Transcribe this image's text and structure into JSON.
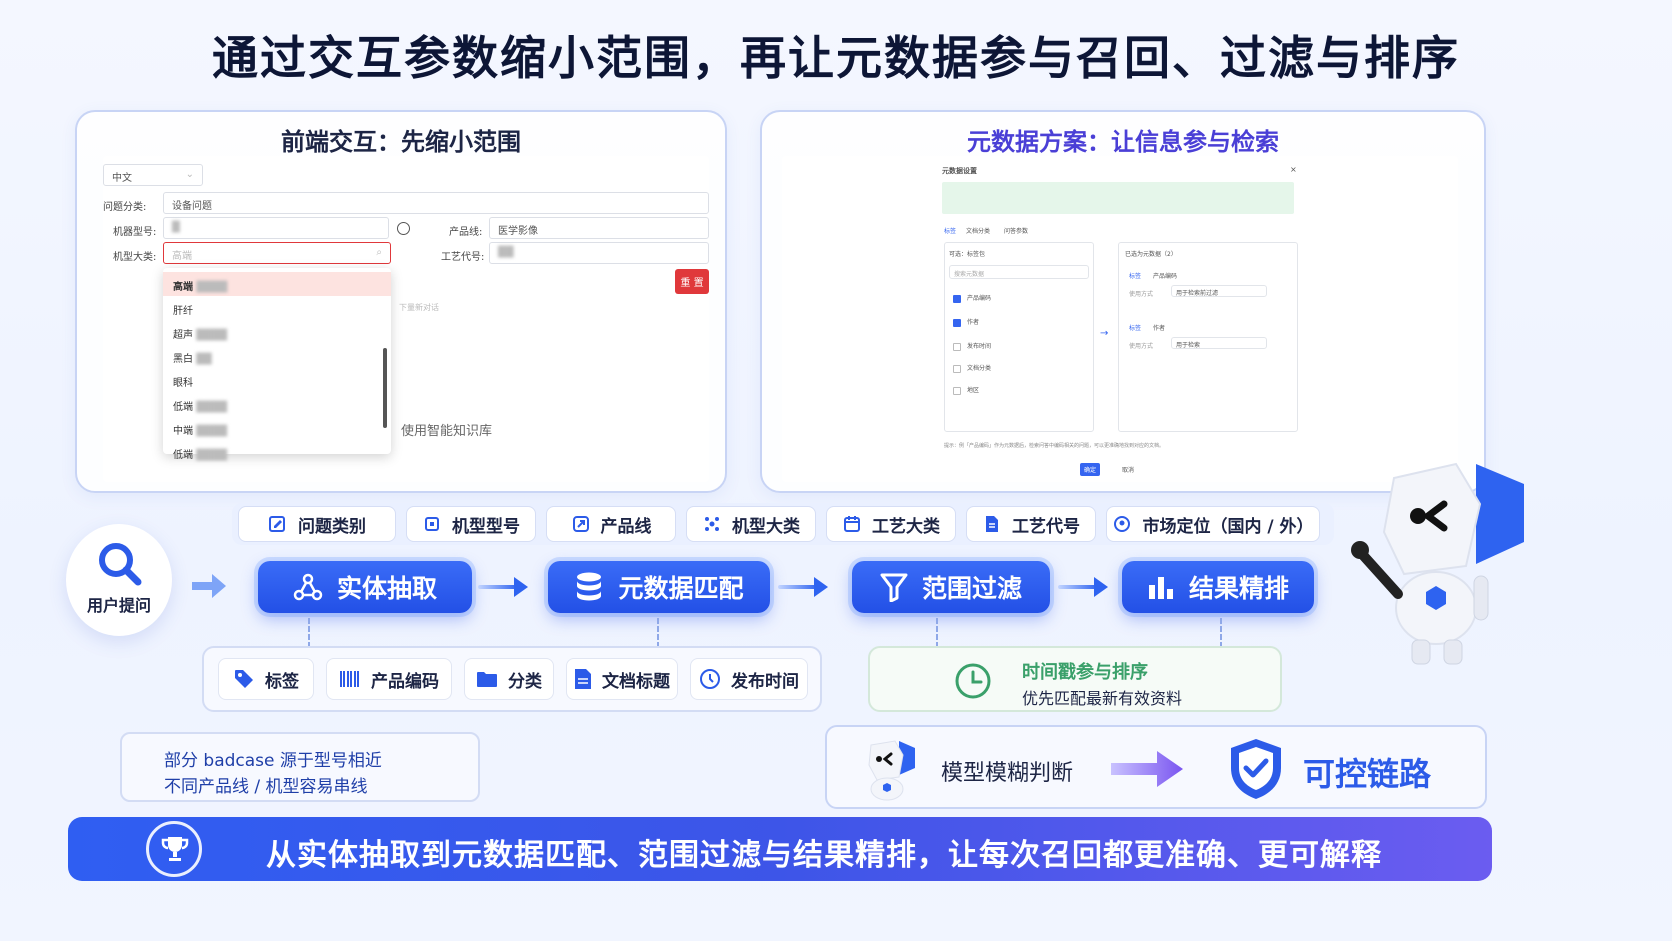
{
  "title": "通过交互参数缩小范围，再让元数据参与召回、过滤与排序",
  "left_panel": {
    "title": "前端交互：先缩小范围",
    "form": {
      "lang_value": "中文",
      "category_label": "问题分类:",
      "category_value": "设备问题",
      "model_label": "机器型号:",
      "line_label": "产品线:",
      "line_value": "医学影像",
      "major_label": "机型大类:",
      "major_placeholder": "高端",
      "craft_label": "工艺代号:",
      "reset_label": "重 置",
      "hint_text": "下量新对话",
      "kb_text": "使用智能知识库"
    },
    "dropdown_items": [
      "高端",
      "肝纤",
      "超声",
      "黑白",
      "眼科",
      "低端",
      "中端",
      "低端"
    ]
  },
  "right_panel": {
    "title": "元数据方案：让信息参与检索",
    "dialog_title": "元数据设置",
    "tabs": [
      "标签",
      "文档分类",
      "问答参数"
    ],
    "left_header": "可选：标签包",
    "search_placeholder": "搜索元数据",
    "options": [
      {
        "label": "产品编码",
        "checked": true
      },
      {
        "label": "作者",
        "checked": true
      },
      {
        "label": "发布时间",
        "checked": false
      },
      {
        "label": "文档分类",
        "checked": false
      },
      {
        "label": "地区",
        "checked": false
      }
    ],
    "right_header": "已选为元数据（2）",
    "selected": [
      {
        "tag": "标签",
        "name": "产品编码",
        "mode_label": "使用方式",
        "mode": "用于检索前过滤"
      },
      {
        "tag": "标签",
        "name": "作者",
        "mode_label": "使用方式",
        "mode": "用于检索"
      }
    ],
    "footer_note": "提示：例「产品编码」作为元数据后，检索问答中编码相关的问题，可以更准确地找到对应的文档。",
    "confirm": "确定",
    "cancel": "取消"
  },
  "params": [
    "问题类别",
    "机型型号",
    "产品线",
    "机型大类",
    "工艺大类",
    "工艺代号",
    "市场定位（国内 / 外）"
  ],
  "user_query_label": "用户提问",
  "flow_steps": [
    "实体抽取",
    "元数据匹配",
    "范围过滤",
    "结果精排"
  ],
  "metadata_fields": [
    "标签",
    "产品编码",
    "分类",
    "文档标题",
    "发布时间"
  ],
  "timestamp_card": {
    "title": "时间戳参与排序",
    "subtitle": "优先匹配最新有效资料"
  },
  "badcase_note": {
    "line1": "部分 badcase 源于型号相近",
    "line2": "不同产品线 / 机型容易串线"
  },
  "control_card": {
    "left_text": "模型模糊判断",
    "right_text": "可控链路"
  },
  "bottom_banner": "从实体抽取到元数据匹配、范围过滤与结果精排，让每次召回都更准确、更可解释",
  "colors": {
    "primary_blue": "#2350e6",
    "title_purple": "#4a3fd6",
    "accent_green": "#3aa06a",
    "reset_red": "#e0383b"
  }
}
